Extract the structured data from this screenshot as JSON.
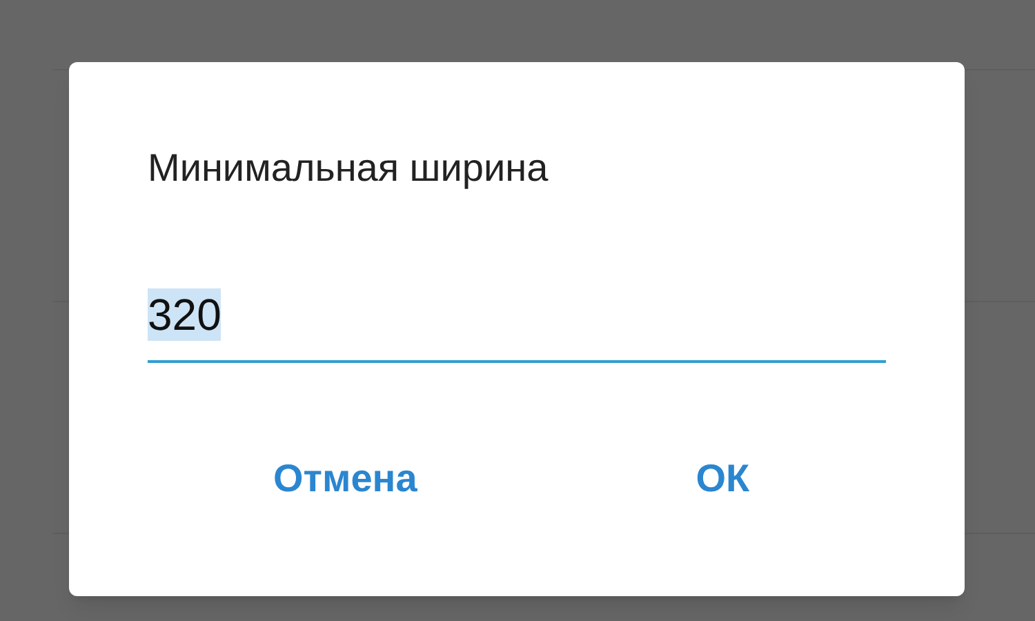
{
  "dialog": {
    "title": "Минимальная ширина",
    "field": {
      "value": "320",
      "selected": true
    },
    "buttons": [
      {
        "label": "Отмена"
      },
      {
        "label": "ОК"
      }
    ]
  }
}
